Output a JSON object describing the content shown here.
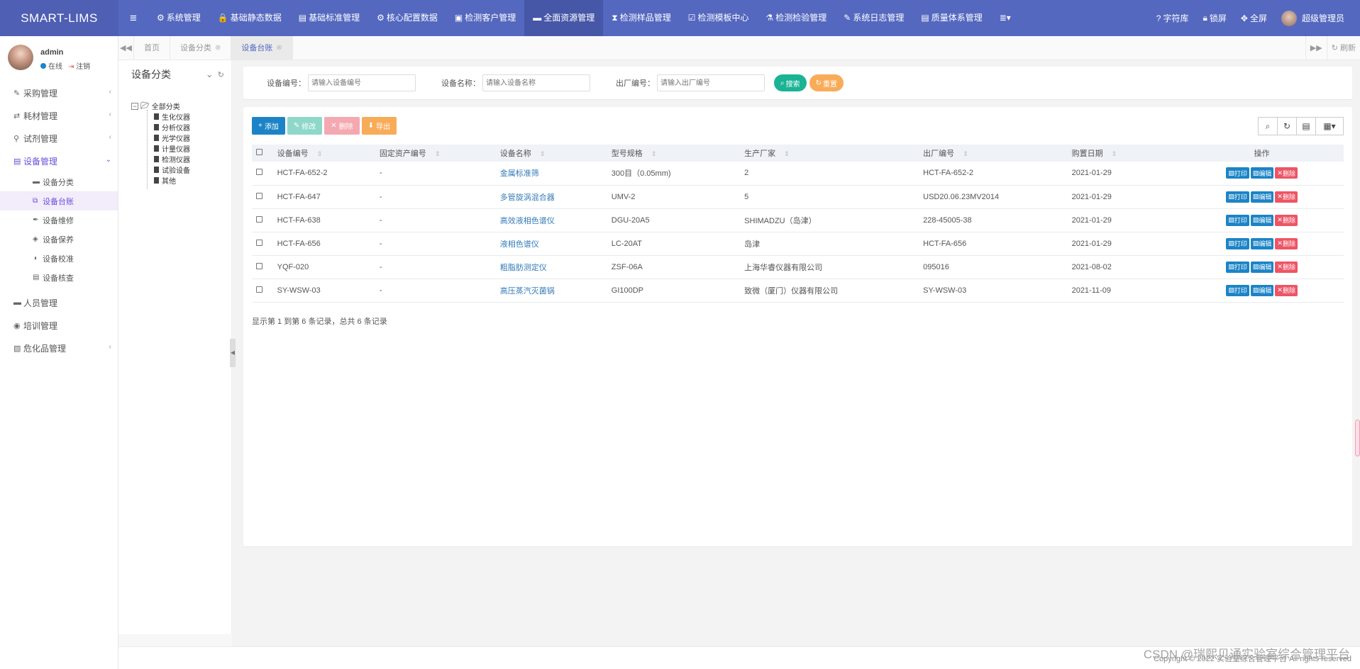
{
  "brand": "SMART-LIMS",
  "topnav": [
    {
      "icon": "⚙",
      "label": "系统管理"
    },
    {
      "icon": "🔒",
      "label": "基础静态数据"
    },
    {
      "icon": "▤",
      "label": "基础标准管理"
    },
    {
      "icon": "⚙",
      "label": "核心配置数据"
    },
    {
      "icon": "▣",
      "label": "检测客户管理"
    },
    {
      "icon": "▬",
      "label": "全面资源管理"
    },
    {
      "icon": "⧗",
      "label": "检测样品管理"
    },
    {
      "icon": "☑",
      "label": "检测模板中心"
    },
    {
      "icon": "⚗",
      "label": "检测检验管理"
    },
    {
      "icon": "✎",
      "label": "系统日志管理"
    },
    {
      "icon": "▤",
      "label": "质量体系管理"
    }
  ],
  "topright": {
    "dict": "字符库",
    "lock": "锁屏",
    "fullscreen": "全屏",
    "user": "超级管理员"
  },
  "profile": {
    "name": "admin",
    "status": "在线",
    "logout": "注销"
  },
  "sidebar": [
    {
      "icon": "✎",
      "label": "采购管理"
    },
    {
      "icon": "⇄",
      "label": "耗材管理"
    },
    {
      "icon": "⚲",
      "label": "试剂管理"
    },
    {
      "icon": "▤",
      "label": "设备管理"
    },
    {
      "icon": "▬",
      "label": "设备分类"
    },
    {
      "icon": "⧉",
      "label": "设备台账"
    },
    {
      "icon": "✒",
      "label": "设备维修"
    },
    {
      "icon": "◈",
      "label": "设备保养"
    },
    {
      "icon": "◑",
      "label": "设备校准"
    },
    {
      "icon": "▤",
      "label": "设备核查"
    },
    {
      "icon": "▬",
      "label": "人员管理"
    },
    {
      "icon": "◉",
      "label": "培训管理"
    },
    {
      "icon": "▧",
      "label": "危化品管理"
    }
  ],
  "tabs": {
    "home": "首页",
    "t1": "设备分类",
    "t2": "设备台账",
    "refresh": "刷新"
  },
  "tree": {
    "title": "设备分类",
    "root": "全部分类",
    "children": [
      "生化仪器",
      "分析仪器",
      "光学仪器",
      "计量仪器",
      "检测仪器",
      "试验设备",
      "其他"
    ]
  },
  "search": {
    "f1_label": "设备编号：",
    "f1_ph": "请输入设备编号",
    "f2_label": "设备名称：",
    "f2_ph": "请输入设备名称",
    "f3_label": "出厂编号：",
    "f3_ph": "请输入出厂编号",
    "search_btn": "搜索",
    "reset_btn": "重置"
  },
  "toolbar": {
    "add": "添加",
    "edit": "修改",
    "del": "删除",
    "export": "导出"
  },
  "table": {
    "headers": [
      "设备编号",
      "固定资产编号",
      "设备名称",
      "型号规格",
      "生产厂家",
      "出厂编号",
      "购置日期",
      "操作"
    ],
    "rows": [
      [
        "HCT-FA-652-2",
        "-",
        "金属标准筛",
        "300目（0.05mm)",
        "2",
        "HCT-FA-652-2",
        "2021-01-29"
      ],
      [
        "HCT-FA-647",
        "-",
        "多管旋涡混合器",
        "UMV-2",
        "5",
        "USD20.06.23MV2014",
        "2021-01-29"
      ],
      [
        "HCT-FA-638",
        "-",
        "高效液相色谱仪",
        "DGU-20A5",
        "SHIMADZU（岛津）",
        "228-45005-38",
        "2021-01-29"
      ],
      [
        "HCT-FA-656",
        "-",
        "液相色谱仪",
        "LC-20AT",
        "岛津",
        "HCT-FA-656",
        "2021-01-29"
      ],
      [
        "YQF-020",
        "-",
        "粗脂肪测定仪",
        "ZSF-06A",
        "上海华睿仪器有限公司",
        "095016",
        "2021-08-02"
      ],
      [
        "SY-WSW-03",
        "-",
        "高压蒸汽灭菌锅",
        "GI100DP",
        "致微（厦门）仪器有限公司",
        "SY-WSW-03",
        "2021-11-09"
      ]
    ],
    "ops": {
      "print": "打印",
      "edit": "编辑",
      "del": "删除"
    }
  },
  "pageinfo": "显示第 1 到第 6 条记录，总共 6 条记录",
  "copyright": "Copyright © 2022 实验室综合管理平台 All rights reserved",
  "watermark": "CSDN @瑞熙贝通实验室综合管理平台",
  "colors": {
    "topbar": "#5468c0",
    "accent": "#6b4fd8",
    "primary": "#1c84c6",
    "success": "#1ab394",
    "danger": "#ed5565",
    "warning": "#f8ac59"
  }
}
